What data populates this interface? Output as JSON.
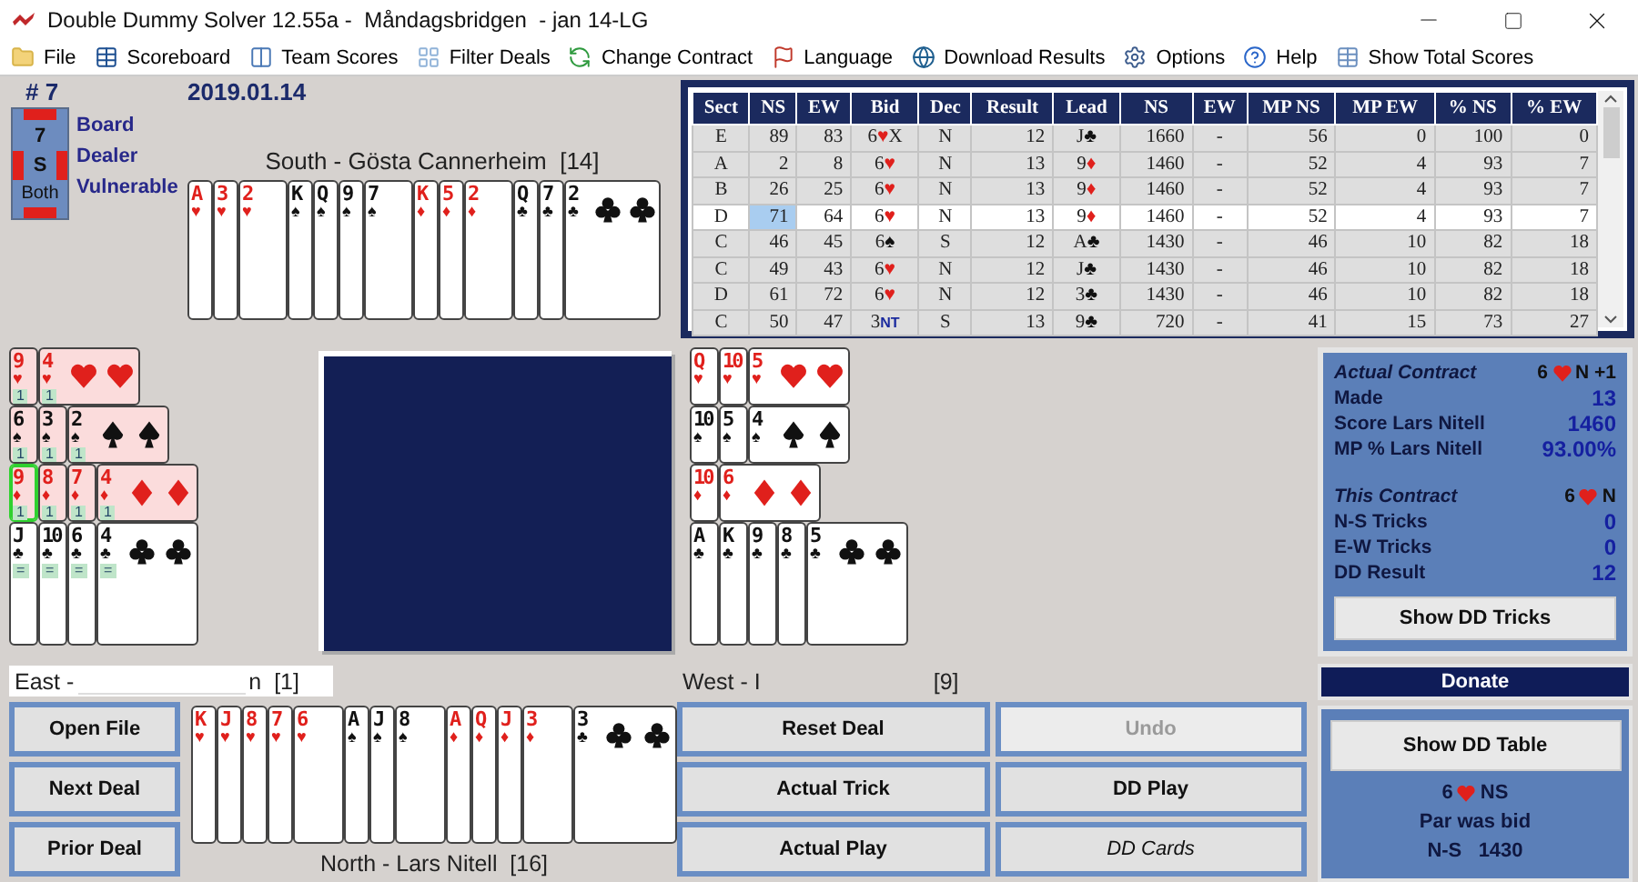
{
  "window": {
    "title": "Double Dummy Solver 12.55a -  Måndagsbridgen  - jan 14-LG"
  },
  "menu": [
    {
      "kind": "folder",
      "label": "File"
    },
    {
      "kind": "table",
      "label": "Scoreboard"
    },
    {
      "kind": "columns",
      "label": "Team Scores"
    },
    {
      "kind": "pattern",
      "label": "Filter Deals"
    },
    {
      "kind": "arrow",
      "label": "Change Contract"
    },
    {
      "kind": "flag",
      "label": "Language"
    },
    {
      "kind": "globe",
      "label": "Download Results"
    },
    {
      "kind": "gear",
      "label": "Options"
    },
    {
      "kind": "help",
      "label": "Help"
    },
    {
      "kind": "grid",
      "label": "Show Total Scores"
    }
  ],
  "board": {
    "number": "# 7",
    "date": "2019.01.14",
    "board": "7",
    "dealer": "S",
    "vulnerability": "Both",
    "vulnerable_ns": true,
    "vulnerable_ew": true,
    "labels": [
      "Board",
      "Dealer",
      "Vulnerable"
    ]
  },
  "south": {
    "label": "South - Gösta Cannerheim  [14]",
    "suits": [
      {
        "kind": "heart",
        "pip": "♥",
        "cards": [
          {
            "rank": "A"
          },
          {
            "rank": "3"
          },
          {
            "rank": "2"
          }
        ]
      },
      {
        "kind": "spade",
        "pip": "♠",
        "cards": [
          {
            "rank": "K"
          },
          {
            "rank": "Q"
          },
          {
            "rank": "9"
          },
          {
            "rank": "7"
          }
        ]
      },
      {
        "kind": "diamond",
        "pip": "♦",
        "cards": [
          {
            "rank": "K"
          },
          {
            "rank": "5"
          },
          {
            "rank": "2"
          }
        ]
      },
      {
        "kind": "club",
        "pip": "♣",
        "cards": [
          {
            "rank": "Q"
          },
          {
            "rank": "7"
          },
          {
            "rank": "2"
          }
        ]
      }
    ]
  },
  "table": {
    "columns": [
      "Sect",
      "NS",
      "EW",
      "Bid",
      "Dec",
      "Result",
      "Lead",
      "NS",
      "EW",
      "MP NS",
      "MP EW",
      "% NS",
      "% EW"
    ],
    "rows": [
      {
        "selected": false,
        "ns_focused": false,
        "sect": "E",
        "ns": "89",
        "ew": "83",
        "bid": {
          "level": "6",
          "strain": "♥",
          "kind": "heart",
          "suffix": "X"
        },
        "dec": "N",
        "result": "12",
        "lead": {
          "rank": "J",
          "pip": "♣",
          "kind": "club"
        },
        "score_ns": "1660",
        "score_ew": "-",
        "mp_ns": "56",
        "mp_ew": "0",
        "pct_ns": "100",
        "pct_ew": "0"
      },
      {
        "selected": false,
        "ns_focused": false,
        "sect": "A",
        "ns": "2",
        "ew": "8",
        "bid": {
          "level": "6",
          "strain": "♥",
          "kind": "heart"
        },
        "dec": "N",
        "result": "13",
        "lead": {
          "rank": "9",
          "pip": "♦",
          "kind": "diamond"
        },
        "score_ns": "1460",
        "score_ew": "-",
        "mp_ns": "52",
        "mp_ew": "4",
        "pct_ns": "93",
        "pct_ew": "7"
      },
      {
        "selected": false,
        "ns_focused": false,
        "sect": "B",
        "ns": "26",
        "ew": "25",
        "bid": {
          "level": "6",
          "strain": "♥",
          "kind": "heart"
        },
        "dec": "N",
        "result": "13",
        "lead": {
          "rank": "9",
          "pip": "♦",
          "kind": "diamond"
        },
        "score_ns": "1460",
        "score_ew": "-",
        "mp_ns": "52",
        "mp_ew": "4",
        "pct_ns": "93",
        "pct_ew": "7"
      },
      {
        "selected": true,
        "ns_focused": true,
        "sect": "D",
        "ns": "71",
        "ew": "64",
        "bid": {
          "level": "6",
          "strain": "♥",
          "kind": "heart"
        },
        "dec": "N",
        "result": "13",
        "lead": {
          "rank": "9",
          "pip": "♦",
          "kind": "diamond"
        },
        "score_ns": "1460",
        "score_ew": "-",
        "mp_ns": "52",
        "mp_ew": "4",
        "pct_ns": "93",
        "pct_ew": "7"
      },
      {
        "selected": false,
        "ns_focused": false,
        "sect": "C",
        "ns": "46",
        "ew": "45",
        "bid": {
          "level": "6",
          "strain": "♠",
          "kind": "spade"
        },
        "dec": "S",
        "result": "12",
        "lead": {
          "rank": "A",
          "pip": "♣",
          "kind": "club"
        },
        "score_ns": "1430",
        "score_ew": "-",
        "mp_ns": "46",
        "mp_ew": "10",
        "pct_ns": "82",
        "pct_ew": "18"
      },
      {
        "selected": false,
        "ns_focused": false,
        "sect": "C",
        "ns": "49",
        "ew": "43",
        "bid": {
          "level": "6",
          "strain": "♥",
          "kind": "heart"
        },
        "dec": "N",
        "result": "12",
        "lead": {
          "rank": "J",
          "pip": "♣",
          "kind": "club"
        },
        "score_ns": "1430",
        "score_ew": "-",
        "mp_ns": "46",
        "mp_ew": "10",
        "pct_ns": "82",
        "pct_ew": "18"
      },
      {
        "selected": false,
        "ns_focused": false,
        "sect": "D",
        "ns": "61",
        "ew": "72",
        "bid": {
          "level": "6",
          "strain": "♥",
          "kind": "heart"
        },
        "dec": "N",
        "result": "12",
        "lead": {
          "rank": "3",
          "pip": "♣",
          "kind": "club"
        },
        "score_ns": "1430",
        "score_ew": "-",
        "mp_ns": "46",
        "mp_ew": "10",
        "pct_ns": "82",
        "pct_ew": "18"
      },
      {
        "selected": false,
        "ns_focused": false,
        "sect": "C",
        "ns": "50",
        "ew": "47",
        "bid": {
          "level": "3",
          "strain": "NT",
          "kind": "notrump"
        },
        "dec": "S",
        "result": "13",
        "lead": {
          "rank": "9",
          "pip": "♣",
          "kind": "club"
        },
        "score_ns": "720",
        "score_ew": "-",
        "mp_ns": "41",
        "mp_ew": "15",
        "pct_ns": "73",
        "pct_ew": "27"
      }
    ]
  },
  "east": {
    "label_start": "East -",
    "label_end": "n",
    "points": "[1]",
    "suits": [
      {
        "kind": "heart",
        "pip": "♥",
        "shaded": true,
        "cards": [
          {
            "rank": "9",
            "tag": "1",
            "selected": false
          },
          {
            "rank": "4",
            "tag": "1",
            "selected": false
          }
        ]
      },
      {
        "kind": "spade",
        "pip": "♠",
        "shaded": true,
        "cards": [
          {
            "rank": "6",
            "tag": "1",
            "selected": false
          },
          {
            "rank": "3",
            "tag": "1",
            "selected": false
          },
          {
            "rank": "2",
            "tag": "1",
            "selected": false
          }
        ]
      },
      {
        "kind": "diamond",
        "pip": "♦",
        "shaded": true,
        "cards": [
          {
            "rank": "9",
            "tag": "1",
            "selected": true
          },
          {
            "rank": "8",
            "tag": "1",
            "selected": false
          },
          {
            "rank": "7",
            "tag": "1",
            "selected": false
          },
          {
            "rank": "4",
            "tag": "1",
            "selected": false
          }
        ]
      },
      {
        "kind": "club",
        "pip": "♣",
        "shaded": false,
        "cards": [
          {
            "rank": "J",
            "tag": "=",
            "selected": false
          },
          {
            "rank": "10",
            "tag": "=",
            "selected": false
          },
          {
            "rank": "6",
            "tag": "=",
            "selected": false
          },
          {
            "rank": "4",
            "tag": "=",
            "selected": false
          }
        ]
      }
    ]
  },
  "west": {
    "label_start": "West - I",
    "points": "[9]",
    "suits": [
      {
        "kind": "heart",
        "pip": "♥",
        "cards": [
          {
            "rank": "Q"
          },
          {
            "rank": "10"
          },
          {
            "rank": "5"
          }
        ]
      },
      {
        "kind": "spade",
        "pip": "♠",
        "cards": [
          {
            "rank": "10"
          },
          {
            "rank": "5"
          },
          {
            "rank": "4"
          }
        ]
      },
      {
        "kind": "diamond",
        "pip": "♦",
        "cards": [
          {
            "rank": "10"
          },
          {
            "rank": "6"
          }
        ]
      },
      {
        "kind": "club",
        "pip": "♣",
        "cards": [
          {
            "rank": "A"
          },
          {
            "rank": "K"
          },
          {
            "rank": "9"
          },
          {
            "rank": "8"
          },
          {
            "rank": "5"
          }
        ]
      }
    ]
  },
  "north": {
    "label": "North - Lars Nitell  [16]",
    "suits": [
      {
        "kind": "heart",
        "pip": "♥",
        "cards": [
          {
            "rank": "K"
          },
          {
            "rank": "J"
          },
          {
            "rank": "8"
          },
          {
            "rank": "7"
          },
          {
            "rank": "6"
          }
        ]
      },
      {
        "kind": "spade",
        "pip": "♠",
        "cards": [
          {
            "rank": "A"
          },
          {
            "rank": "J"
          },
          {
            "rank": "8"
          }
        ]
      },
      {
        "kind": "diamond",
        "pip": "♦",
        "cards": [
          {
            "rank": "A"
          },
          {
            "rank": "Q"
          },
          {
            "rank": "J"
          },
          {
            "rank": "3"
          }
        ]
      },
      {
        "kind": "club",
        "pip": "♣",
        "cards": [
          {
            "rank": "3"
          }
        ]
      }
    ]
  },
  "info": {
    "actual": {
      "label": "Actual Contract",
      "level": "6",
      "kind": "heart",
      "rest": "N +1"
    },
    "actual_rows": [
      {
        "label": "Made",
        "value": "13"
      },
      {
        "label": "Score Lars Nitell",
        "value": "1460"
      },
      {
        "label": "MP % Lars Nitell",
        "value": "93.00%"
      }
    ],
    "this": {
      "label": "This Contract",
      "level": "6",
      "kind": "heart",
      "rest": "N"
    },
    "this_rows": [
      {
        "label": "N-S Tricks",
        "value": "0"
      },
      {
        "label": "E-W Tricks",
        "value": "0"
      },
      {
        "label": "DD Result",
        "value": "12"
      }
    ],
    "button": "Show DD Tricks"
  },
  "left_buttons": [
    {
      "label": "Open File",
      "disabled": false,
      "italic": false
    },
    {
      "label": "Next Deal",
      "disabled": false,
      "italic": false
    },
    {
      "label": "Prior Deal",
      "disabled": false,
      "italic": false
    }
  ],
  "play_buttons": [
    {
      "label": "Reset Deal",
      "disabled": false,
      "italic": false
    },
    {
      "label": "Undo",
      "disabled": true,
      "italic": false
    },
    {
      "label": "Actual Trick",
      "disabled": false,
      "italic": false
    },
    {
      "label": "DD Play",
      "disabled": false,
      "italic": false
    },
    {
      "label": "Actual Play",
      "disabled": false,
      "italic": false
    },
    {
      "label": "DD Cards",
      "disabled": false,
      "italic": true
    }
  ],
  "donate": "Donate",
  "par": {
    "button": "Show DD Table",
    "level": "6",
    "kind": "heart",
    "strain_rest": "NS",
    "note": "Par was bid",
    "side": "N-S",
    "score": "1430"
  }
}
